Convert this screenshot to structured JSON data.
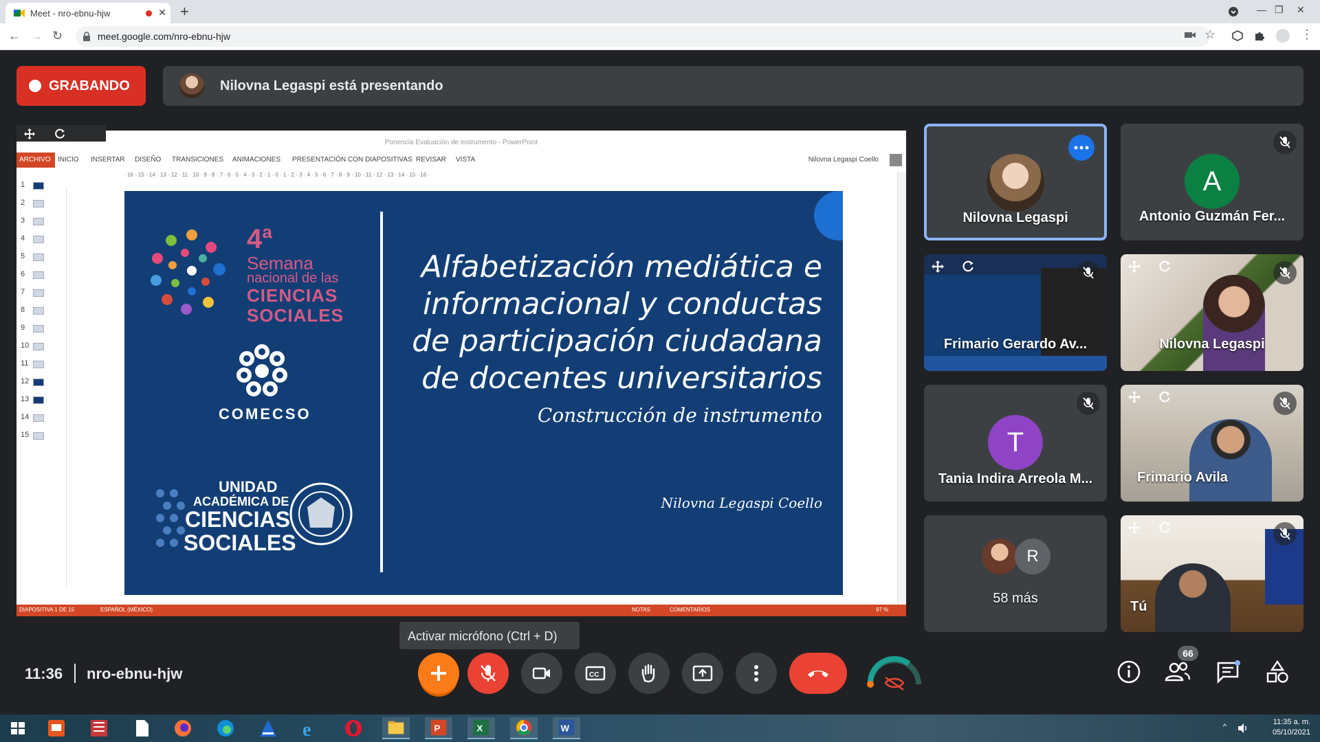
{
  "browser": {
    "tab_title": "Meet - nro-ebnu-hjw",
    "url": "meet.google.com/nro-ebnu-hjw"
  },
  "banner": {
    "recording_label": "GRABANDO",
    "presenting_text": "Nilovna Legaspi está presentando"
  },
  "powerpoint": {
    "window_title": "Ponencia Evaluación de instrumento - PowerPoint",
    "ribbon_tabs": [
      "ARCHIVO",
      "INICIO",
      "INSERTAR",
      "DISEÑO",
      "TRANSICIONES",
      "ANIMACIONES",
      "PRESENTACIÓN CON DIAPOSITIVAS",
      "REVISAR",
      "VISTA"
    ],
    "user": "Nilovna Legaspi Coello",
    "ruler": "· 16 · 15 · 14 · 13 · 12 · 11 · 10 · 9 · 8 · 7 · 6 · 5 · 4 · 3 · 2 · 1 · 0 · 1 · 2 · 3 · 4 · 5 · 6 · 7 · 8 · 9 · 10 · 11 · 12 · 13 · 14 · 15 · 16 ·",
    "slide_numbers": [
      "1",
      "2",
      "3",
      "4",
      "5",
      "6",
      "7",
      "8",
      "9",
      "10",
      "11",
      "12",
      "13",
      "14",
      "15"
    ],
    "status": {
      "slide": "DIAPOSITIVA 1 DE 15",
      "language": "ESPAÑOL (MÉXICO)",
      "notes": "NOTAS",
      "comments": "COMENTARIOS",
      "zoom": "97 %"
    },
    "slide": {
      "sem_number": "4ª",
      "sem_line1": "Semana",
      "sem_line2": "nacional de las",
      "sem_line3": "CIENCIAS",
      "sem_line4": "SOCIALES",
      "comecso": "COMECSO",
      "ua_line1": "UNIDAD",
      "ua_line2": "ACADÉMICA DE",
      "ua_line3": "CIENCIAS",
      "ua_line4": "SOCIALES",
      "title_lines": [
        "Alfabetización mediática e",
        "informacional y conductas",
        "de participación ciudadana",
        "de docentes universitarios"
      ],
      "subtitle": "Construcción de instrumento",
      "author": "Nilovna Legaspi Coello"
    }
  },
  "participants": [
    {
      "name": "Nilovna Legaspi",
      "type": "avatar-photo",
      "active": true
    },
    {
      "name": "Antonio Guzmán Fer...",
      "type": "letter",
      "letter": "A",
      "color": "#0b8043",
      "muted": true
    },
    {
      "name": "Frimario Gerardo Av...",
      "type": "screen",
      "muted": true
    },
    {
      "name": "Nilovna Legaspi",
      "type": "video",
      "muted": true
    },
    {
      "name": "Tania Indira Arreola M...",
      "type": "letter",
      "letter": "T",
      "color": "#8e44c4",
      "muted": true
    },
    {
      "name": "Frimario Avila",
      "type": "video",
      "muted": true
    },
    {
      "name": "58 más",
      "type": "overflow",
      "letter": "R"
    },
    {
      "name": "Tú",
      "type": "video",
      "muted": true
    }
  ],
  "controls": {
    "tooltip": "Activar micrófono (Ctrl + D)",
    "time": "11:36",
    "meeting_code": "nro-ebnu-hjw",
    "people_count": "66",
    "accent": "#ea4335"
  },
  "taskbar": {
    "time": "11:35 a. m.",
    "date": "05/10/2021"
  }
}
